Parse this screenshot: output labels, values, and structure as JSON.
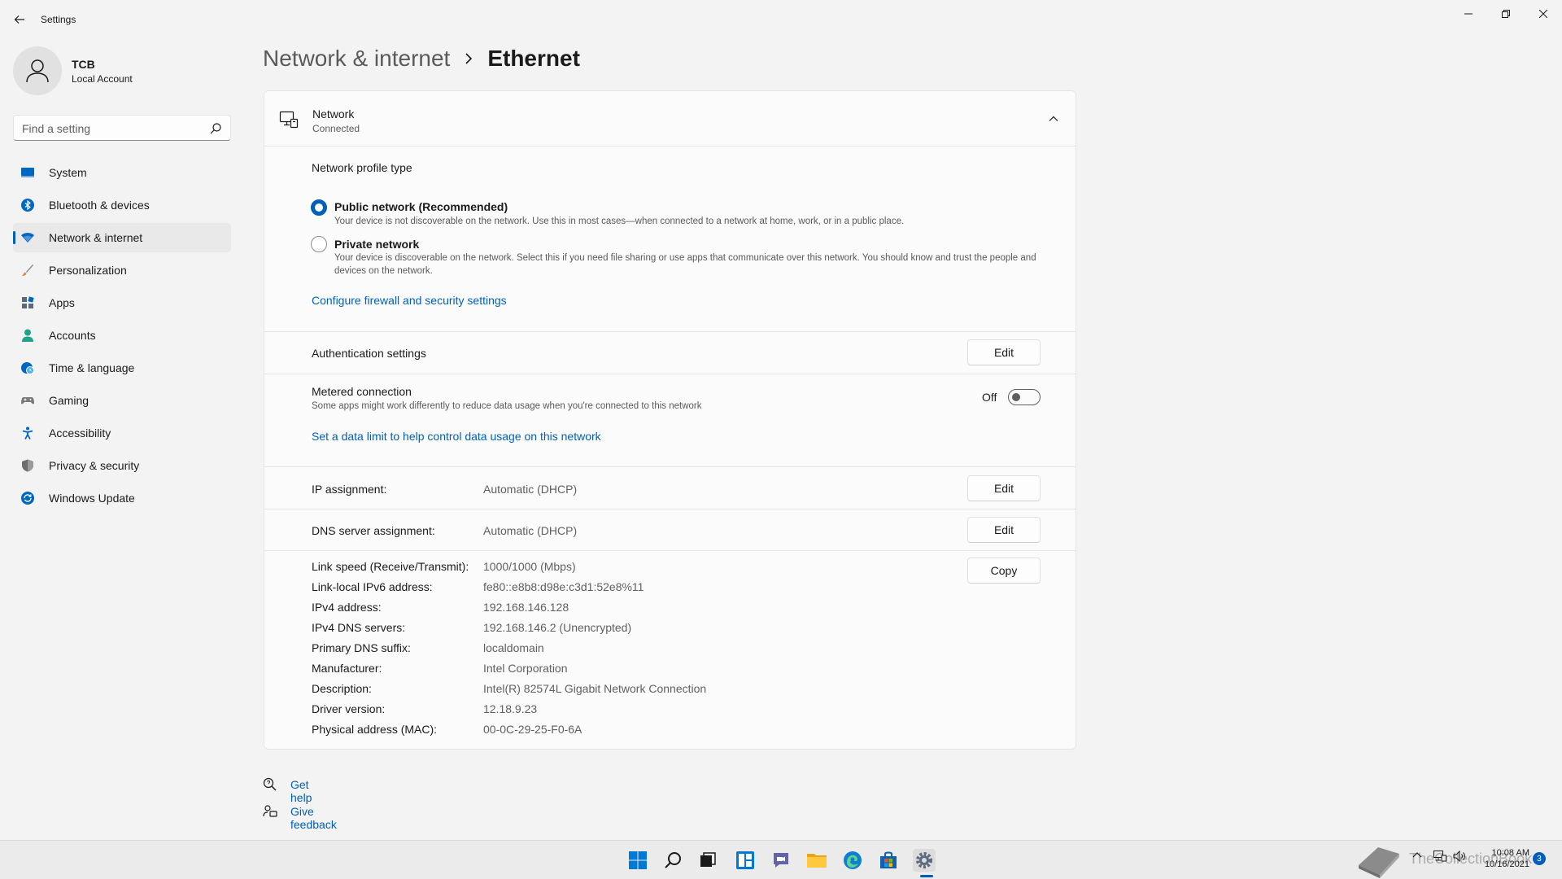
{
  "window": {
    "title": "Settings"
  },
  "user": {
    "name": "TCB",
    "account_type": "Local Account"
  },
  "search": {
    "placeholder": "Find a setting"
  },
  "sidebar": {
    "items": [
      {
        "label": "System",
        "icon": "monitor-icon",
        "color": "#0067c0"
      },
      {
        "label": "Bluetooth & devices",
        "icon": "bluetooth-icon",
        "color": "#0067c0"
      },
      {
        "label": "Network & internet",
        "icon": "wifi-icon",
        "color": "#0067c0",
        "active": true
      },
      {
        "label": "Personalization",
        "icon": "brush-icon",
        "color": "#e3893b"
      },
      {
        "label": "Apps",
        "icon": "apps-icon",
        "color": "#5b6a7a"
      },
      {
        "label": "Accounts",
        "icon": "person-icon",
        "color": "#1fa38a"
      },
      {
        "label": "Time & language",
        "icon": "globe-clock-icon",
        "color": "#0067c0"
      },
      {
        "label": "Gaming",
        "icon": "gamepad-icon",
        "color": "#7a7a7a"
      },
      {
        "label": "Accessibility",
        "icon": "accessibility-icon",
        "color": "#0067c0"
      },
      {
        "label": "Privacy & security",
        "icon": "shield-icon",
        "color": "#6d6d6d"
      },
      {
        "label": "Windows Update",
        "icon": "update-icon",
        "color": "#0067c0"
      }
    ]
  },
  "breadcrumb": {
    "parent": "Network & internet",
    "current": "Ethernet"
  },
  "network": {
    "name": "Network",
    "status": "Connected",
    "profile_heading": "Network profile type",
    "public_label": "Public network (Recommended)",
    "public_desc": "Your device is not discoverable on the network. Use this in most cases—when connected to a network at home, work, or in a public place.",
    "private_label": "Private network",
    "private_desc": "Your device is discoverable on the network. Select this if you need file sharing or use apps that communicate over this network. You should know and trust the people and devices on the network.",
    "selected_profile": "public",
    "firewall_link": "Configure firewall and security settings"
  },
  "auth": {
    "label": "Authentication settings",
    "button": "Edit"
  },
  "metered": {
    "label": "Metered connection",
    "desc": "Some apps might work differently to reduce data usage when you're connected to this network",
    "state": "Off",
    "data_limit_link": "Set a data limit to help control data usage on this network"
  },
  "ip_assignment": {
    "label": "IP assignment:",
    "value": "Automatic (DHCP)",
    "button": "Edit"
  },
  "dns_assignment": {
    "label": "DNS server assignment:",
    "value": "Automatic (DHCP)",
    "button": "Edit"
  },
  "properties": {
    "copy_button": "Copy",
    "rows": [
      {
        "label": "Link speed (Receive/Transmit):",
        "value": "1000/1000 (Mbps)"
      },
      {
        "label": "Link-local IPv6 address:",
        "value": "fe80::e8b8:d98e:c3d1:52e8%11"
      },
      {
        "label": "IPv4 address:",
        "value": "192.168.146.128"
      },
      {
        "label": "IPv4 DNS servers:",
        "value": "192.168.146.2 (Unencrypted)"
      },
      {
        "label": "Primary DNS suffix:",
        "value": "localdomain"
      },
      {
        "label": "Manufacturer:",
        "value": "Intel Corporation"
      },
      {
        "label": "Description:",
        "value": "Intel(R) 82574L Gigabit Network Connection"
      },
      {
        "label": "Driver version:",
        "value": "12.18.9.23"
      },
      {
        "label": "Physical address (MAC):",
        "value": "00-0C-29-25-F0-6A"
      }
    ]
  },
  "help": {
    "get_help": "Get help",
    "give_feedback": "Give feedback"
  },
  "taskbar": {
    "time": "10:08 AM",
    "date": "10/16/2021",
    "notification_count": "3",
    "watermark": "TheCollectionBook"
  },
  "colors": {
    "accent": "#005fb8",
    "link": "#005fb8"
  }
}
